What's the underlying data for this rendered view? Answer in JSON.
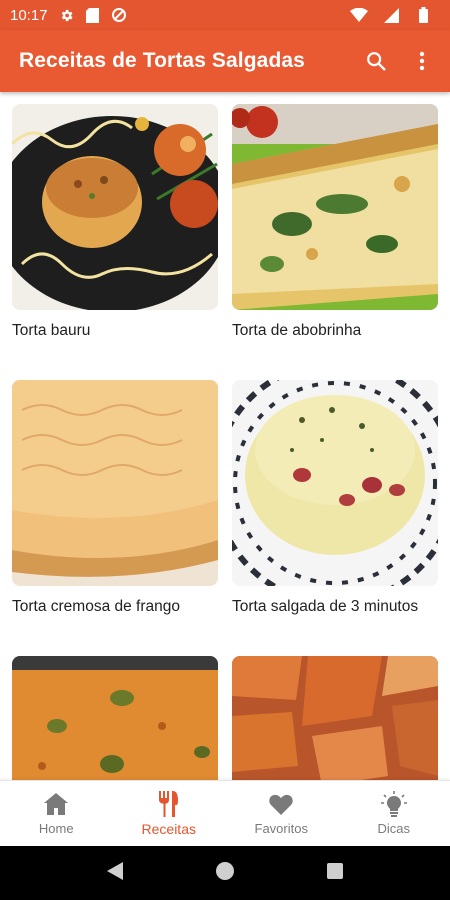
{
  "status_bar": {
    "time": "10:17"
  },
  "app_bar": {
    "title": "Receitas de Tortas Salgadas"
  },
  "recipes": [
    {
      "name": "Torta bauru"
    },
    {
      "name": "Torta de abobrinha"
    },
    {
      "name": "Torta cremosa de frango"
    },
    {
      "name": "Torta salgada de 3 minutos"
    },
    {
      "name": ""
    },
    {
      "name": ""
    }
  ],
  "bottom_nav": {
    "items": [
      {
        "label": "Home",
        "icon": "home-icon"
      },
      {
        "label": "Receitas",
        "icon": "fork-knife-icon",
        "active": true
      },
      {
        "label": "Favoritos",
        "icon": "heart-icon"
      },
      {
        "label": "Dicas",
        "icon": "lightbulb-icon"
      }
    ]
  },
  "colors": {
    "primary": "#ea5a32",
    "status_bar": "#e4562f",
    "active_nav": "#e4562f"
  }
}
